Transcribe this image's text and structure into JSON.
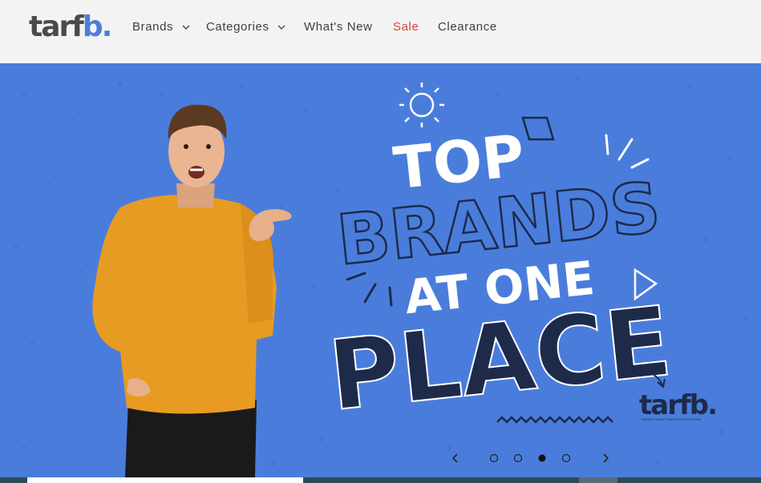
{
  "logo": {
    "part1": "tarf",
    "part2": "b."
  },
  "nav": {
    "items": [
      {
        "label": "Brands",
        "has_dropdown": true
      },
      {
        "label": "Categories",
        "has_dropdown": true
      },
      {
        "label": "What's New",
        "has_dropdown": false
      },
      {
        "label": "Sale",
        "has_dropdown": false,
        "color": "#d9443a"
      },
      {
        "label": "Clearance",
        "has_dropdown": false
      }
    ]
  },
  "hero": {
    "headline_line1": "TOP",
    "headline_line2": "BRANDS",
    "headline_line3": "AT ONE",
    "headline_line4": "PLACE",
    "brand_mark": "tarfb.",
    "brand_tagline": "THERE'S SOMETHING FOR EVERYONE",
    "background_color": "#4a7ddb",
    "slides_total": 4,
    "active_slide": 3
  },
  "colors": {
    "accent_blue": "#4c7fd9",
    "sale_red": "#d9443a",
    "headline_navy": "#1d2a4a"
  }
}
